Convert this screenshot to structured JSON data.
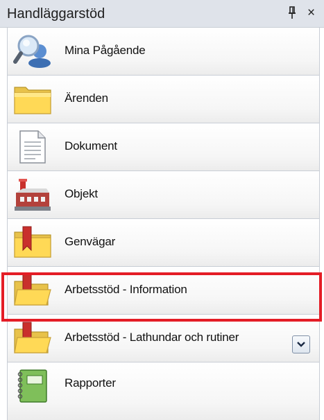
{
  "panel": {
    "title": "Handläggarstöd",
    "pin_glyph": "Ꝗ",
    "close_glyph": "×"
  },
  "items": [
    {
      "label": "Mina Pågående",
      "icon": "magnifier-user-icon"
    },
    {
      "label": "Ärenden",
      "icon": "folder-icon"
    },
    {
      "label": "Dokument",
      "icon": "document-icon"
    },
    {
      "label": "Objekt",
      "icon": "building-icon"
    },
    {
      "label": "Genvägar",
      "icon": "bookmark-folder-icon"
    },
    {
      "label": "Arbetsstöd - Information",
      "icon": "bookmark-folder-open-icon",
      "selected": true
    },
    {
      "label": "Arbetsstöd - Lathundar och rutiner",
      "icon": "bookmark-folder-open-icon"
    },
    {
      "label": "Rapporter",
      "icon": "notebook-icon"
    }
  ],
  "colors": {
    "highlight": "#e41d26",
    "titlebar": "#dfe3ea"
  }
}
